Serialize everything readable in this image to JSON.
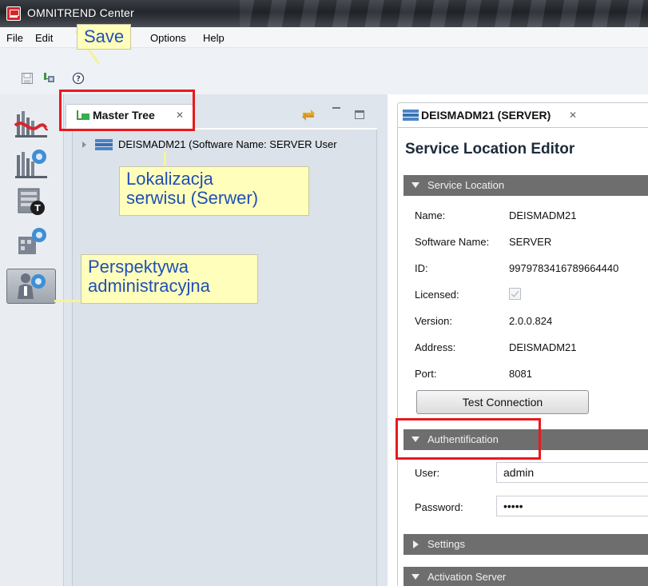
{
  "window": {
    "title": "OMNITREND Center",
    "accent": "#e8191e"
  },
  "menu": {
    "items": [
      "File",
      "Edit",
      "Options",
      "Help"
    ]
  },
  "toolbar": {
    "icons": [
      "save-icon",
      "network-icon",
      "help-icon"
    ]
  },
  "perspectives": {
    "items": [
      "chart-perspective",
      "settings-perspective",
      "terminal-perspective",
      "config-perspective",
      "admin-perspective"
    ],
    "active": "admin-perspective"
  },
  "master_tree": {
    "tab_label": "Master Tree",
    "node_label": "DEISMADM21 (Software Name: SERVER User"
  },
  "editor": {
    "tab_label": "DEISMADM21 (SERVER)",
    "title": "Service Location Editor",
    "service_location": {
      "header": "Service Location",
      "fields": [
        {
          "label": "Name:",
          "value": "DEISMADM21"
        },
        {
          "label": "Software Name:",
          "value": "SERVER"
        },
        {
          "label": "ID:",
          "value": "9979783416789664440"
        },
        {
          "label": "Licensed:",
          "value": ""
        },
        {
          "label": "Version:",
          "value": "2.0.0.824"
        },
        {
          "label": "Address:",
          "value": "DEISMADM21"
        },
        {
          "label": "Port:",
          "value": "8081"
        }
      ],
      "licensed_checked": true,
      "test_button": "Test Connection"
    },
    "authentication": {
      "header": "Authentification",
      "user_label": "User:",
      "user_value": "admin",
      "password_label": "Password:",
      "password_value": "•••••"
    },
    "settings_header": "Settings",
    "activation_header": "Activation Server"
  },
  "callouts": {
    "save": "Save",
    "service_location_line1": "Lokalizacja",
    "service_location_line2": "serwisu (Serwer)",
    "perspective_line1": "Perspektywa",
    "perspective_line2": "administracyjna"
  }
}
